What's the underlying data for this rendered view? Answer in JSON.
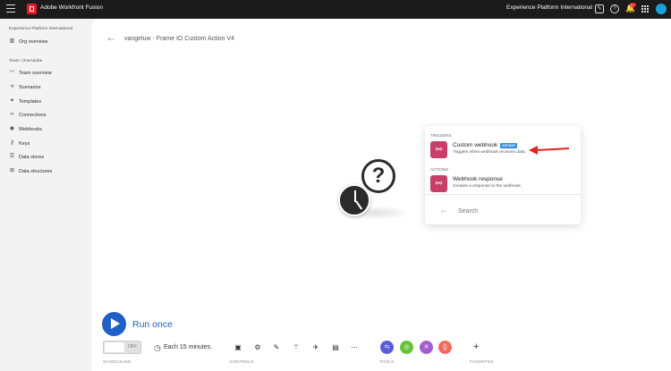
{
  "topbar": {
    "app_title": "Adobe Workfront Fusion",
    "org_name": "Experience Platform International",
    "notification_count": "9+"
  },
  "sidebar": {
    "org_section": "Experience Platform International",
    "org_overview": "Org overview",
    "team_section": "Team: OneAdobe",
    "items": [
      {
        "label": "Team overview",
        "icon": "pulse-icon"
      },
      {
        "label": "Scenarios",
        "icon": "share-icon"
      },
      {
        "label": "Templates",
        "icon": "puzzle-icon"
      },
      {
        "label": "Connections",
        "icon": "link-icon"
      },
      {
        "label": "Webhooks",
        "icon": "globe-icon"
      },
      {
        "label": "Keys",
        "icon": "key-icon"
      },
      {
        "label": "Data stores",
        "icon": "database-icon"
      },
      {
        "label": "Data structures",
        "icon": "structure-icon"
      }
    ]
  },
  "scenario": {
    "name": "vangeluw - Frame IO Custom Action V4"
  },
  "popup": {
    "triggers_label": "TRIGGERS",
    "trigger": {
      "title": "Custom webhook",
      "badge": "INSTANT",
      "description": "Triggers when webhook receives data."
    },
    "actions_label": "ACTIONS",
    "action": {
      "title": "Webhook response",
      "description": "Creates a response to the webhook."
    },
    "search_placeholder": "Search"
  },
  "toolbar": {
    "run_once": "Run once",
    "toggle_label": "OFF",
    "schedule_text": "Each 15 minutes.",
    "scheduling_caption": "SCHEDULING",
    "controls_caption": "CONTROLS",
    "tools_caption": "TOOLS",
    "favorites_caption": "FAVORITES"
  },
  "colors": {
    "accent": "#1f5fc7",
    "webhook_module": "#c83e66",
    "instant_badge": "#2d8ae5",
    "tool_flow": "#5b5bd6",
    "tool_green": "#67c23a",
    "tool_purple": "#a35fd1",
    "tool_orange": "#ef6c5c"
  }
}
